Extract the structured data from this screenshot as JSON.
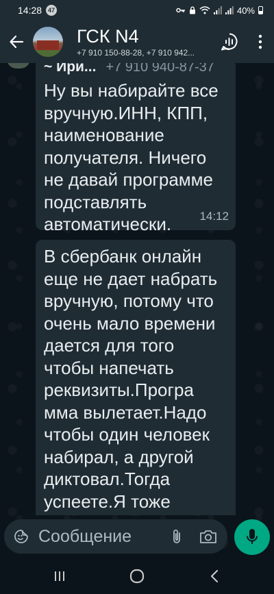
{
  "status_bar": {
    "time": "14:28",
    "notification_count": "47",
    "battery": "40%"
  },
  "header": {
    "title": "ГСК N4",
    "members": "+7 910 150-88-28, +7 910 942..."
  },
  "messages": [
    {
      "sender": "~ Ири...",
      "sender_phone": "+7 910 940-87-37",
      "text": "Ну вы набирайте все вручную.ИНН, КПП, наименование получателя. Ничего не давай программе подставлять автоматически.",
      "time": "14:12"
    },
    {
      "text": "В сбербанк онлайн еще не дает набрать вручную, потому что очень мало времени дается для того чтобы напечать реквизиты.Програ мма вылетает.Надо чтобы один человек набирал, а другой диктовал.Тогда успеете.Я тоже мучалась сначала"
    }
  ],
  "composer": {
    "placeholder": "Сообщение"
  },
  "colors": {
    "accent": "#00a884",
    "bubble": "#1f2c34",
    "background": "#0b141a"
  }
}
